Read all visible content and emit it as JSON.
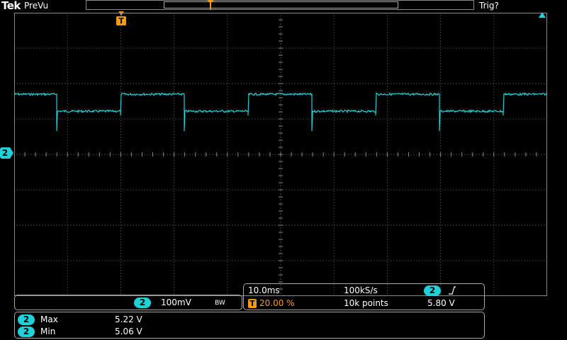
{
  "header": {
    "brand": "Tek",
    "status": "PreVu",
    "trigger_status": "Trig?"
  },
  "trigger_marker": {
    "label": "T"
  },
  "channel": {
    "number": "2",
    "scale": "100mV",
    "bandwidth_icon": "BW",
    "color": "#1fd1d8"
  },
  "timebase": {
    "time_per_div": "10.0ms",
    "sample_rate": "100kS/s",
    "trigger_source": "2",
    "trigger_slope_icon": "rising-edge-icon",
    "trigger_position_label": "T",
    "trigger_position": "20.00 %",
    "record_length": "10k points",
    "trigger_level": "5.80 V"
  },
  "measurements": [
    {
      "channel": "2",
      "name": "Max",
      "value": "5.22 V"
    },
    {
      "channel": "2",
      "name": "Min",
      "value": "5.06 V"
    }
  ],
  "colors": {
    "trace": "#1fd1d8",
    "trigger": "#f39c12",
    "grid": "#6e6e6e"
  }
}
